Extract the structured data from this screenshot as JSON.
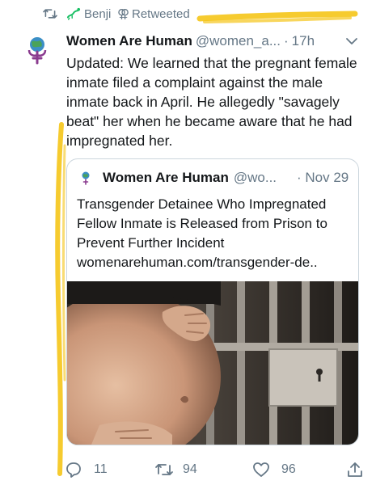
{
  "retweet": {
    "user": "Benji",
    "label": "Retweeted",
    "symbol": "⚢"
  },
  "tweet": {
    "author_name": "Women Are Human",
    "author_handle": "@women_a...",
    "separator": "·",
    "time": "17h",
    "text": "Updated: We learned that the pregnant female inmate filed a complaint against the male inmate back in April. He allegedly \"savagely beat\" her when he became aware that he had impregnated her."
  },
  "quote": {
    "author_name": "Women Are Human",
    "author_handle": "@wo...",
    "date": "· Nov 29",
    "text": "Transgender Detainee Who Impregnated Fellow Inmate is Released from Prison to Prevent Further Incident",
    "link": "womenarehuman.com/transgender-de.."
  },
  "actions": {
    "replies": "11",
    "retweets": "94",
    "likes": "96"
  },
  "colors": {
    "retweet_green": "#17bf63",
    "muted": "#657786",
    "highlight": "#f5c518"
  },
  "icons": [
    "retweet-icon",
    "chevron-down-icon",
    "reply-icon",
    "like-icon",
    "share-icon"
  ]
}
